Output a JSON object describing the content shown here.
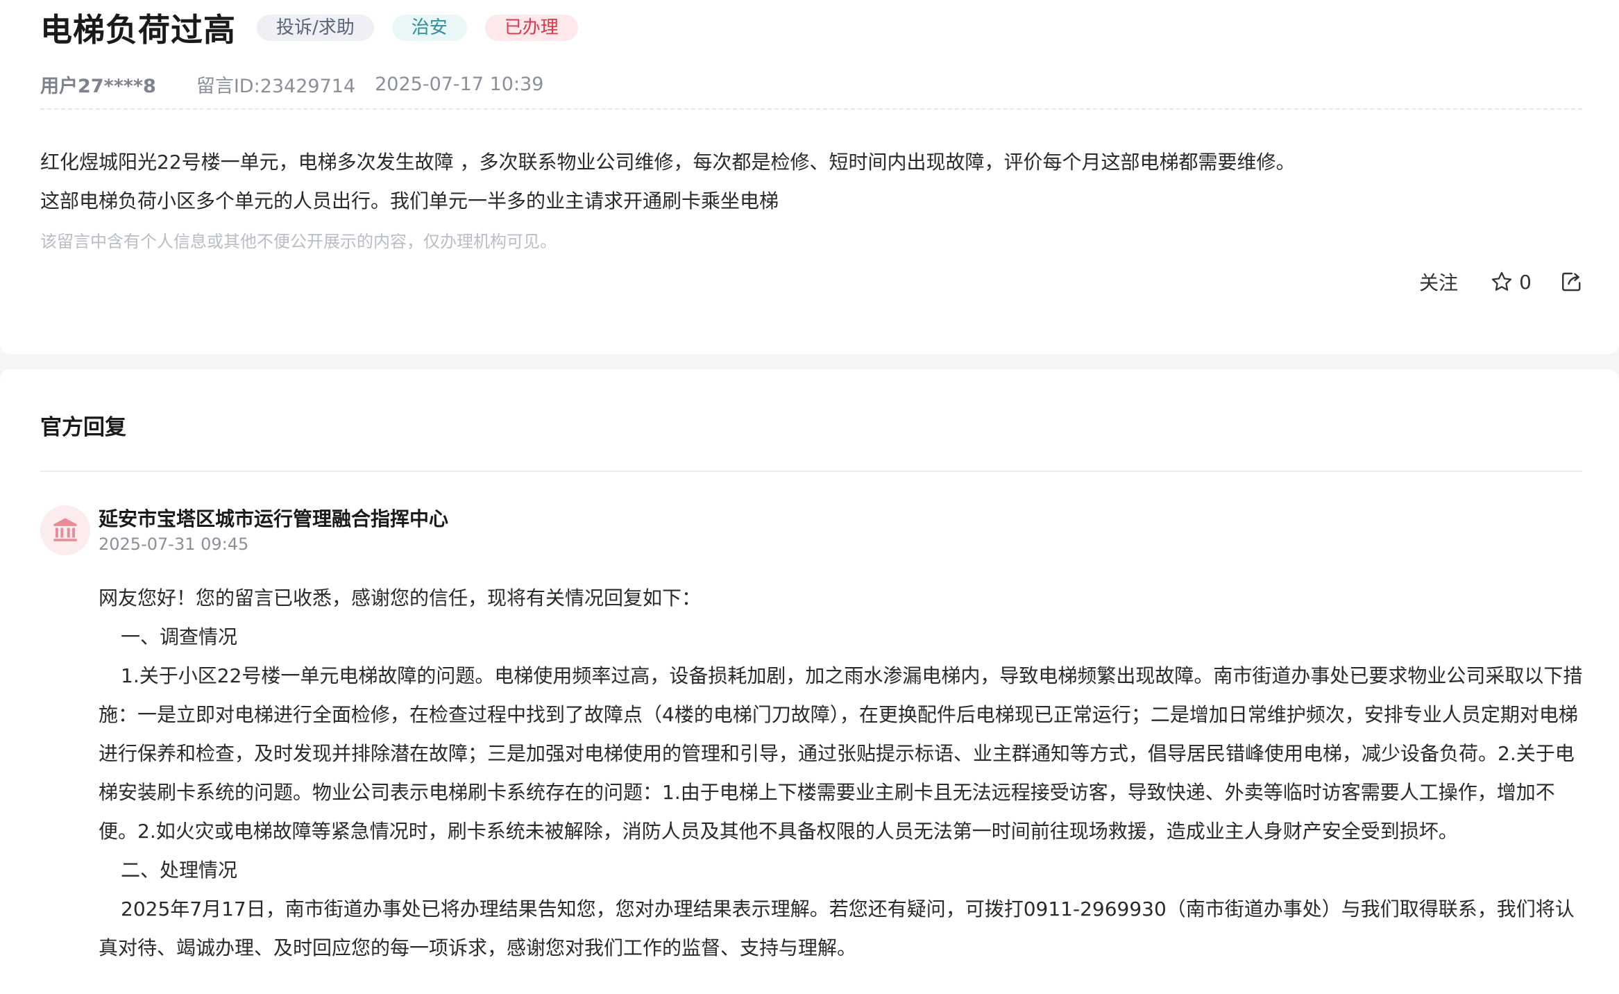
{
  "post": {
    "title": "电梯负荷过高",
    "tags": {
      "type": "投诉/求助",
      "category": "治安",
      "status": "已办理"
    },
    "user": "用户27****8",
    "message_id": "留言ID:23429714",
    "datetime": "2025-07-17 10:39",
    "content_line1": "红化煜城阳光22号楼一单元，电梯多次发生故障 ，多次联系物业公司维修，每次都是检修、短时间内出现故障，评价每个月这部电梯都需要维修。",
    "content_line2": "这部电梯负荷小区多个单元的人员出行。我们单元一半多的业主请求开通刷卡乘坐电梯",
    "privacy_note": "该留言中含有个人信息或其他不便公开展示的内容，仅办理机构可见。"
  },
  "actions": {
    "follow_label": "关注",
    "like_count": "0"
  },
  "reply": {
    "section_title": "官方回复",
    "org_name": "延安市宝塔区城市运行管理融合指挥中心",
    "datetime": "2025-07-31 09:45",
    "greeting": "网友您好！您的留言已收悉，感谢您的信任，现将有关情况回复如下：",
    "heading1": "一、调查情况",
    "para1": "1.关于小区22号楼一单元电梯故障的问题。电梯使用频率过高，设备损耗加剧，加之雨水渗漏电梯内，导致电梯频繁出现故障。南市街道办事处已要求物业公司采取以下措施：一是立即对电梯进行全面检修，在检查过程中找到了故障点（4楼的电梯门刀故障），在更换配件后电梯现已正常运行；二是增加日常维护频次，安排专业人员定期对电梯进行保养和检查，及时发现并排除潜在故障；三是加强对电梯使用的管理和引导，通过张贴提示标语、业主群通知等方式，倡导居民错峰使用电梯，减少设备负荷。2.关于电梯安装刷卡系统的问题。物业公司表示电梯刷卡系统存在的问题：1.由于电梯上下楼需要业主刷卡且无法远程接受访客，导致快递、外卖等临时访客需要人工操作，增加不便。2.如火灾或电梯故障等紧急情况时，刷卡系统未被解除，消防人员及其他不具备权限的人员无法第一时间前往现场救援，造成业主人身财产安全受到损坏。",
    "heading2": "二、处理情况",
    "para2": "2025年7月17日，南市街道办事处已将办理结果告知您，您对办理结果表示理解。若您还有疑问，可拨打0911-2969930（南市街道办事处）与我们取得联系，我们将认真对待、竭诚办理、及时回应您的每一项诉求，感谢您对我们工作的监督、支持与理解。"
  },
  "icons": {
    "like": "star-icon",
    "share": "share-icon",
    "avatar": "government-building-icon"
  },
  "colors": {
    "status_red": "#d93a4c",
    "category_teal": "#2b8f9e",
    "type_gray": "#5a6478"
  }
}
